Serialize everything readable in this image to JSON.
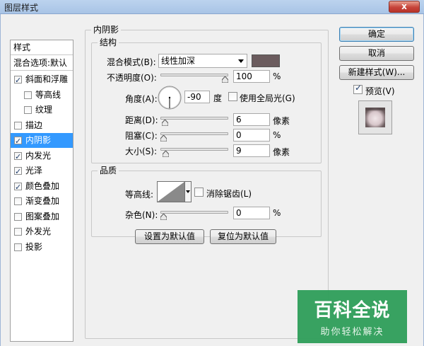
{
  "window": {
    "title": "图层样式",
    "close_label": "x"
  },
  "style_list": {
    "header": "样式",
    "blend_options": "混合选项:默认",
    "items": [
      {
        "label": "斜面和浮雕",
        "checked": true,
        "indent": false
      },
      {
        "label": "等高线",
        "checked": false,
        "indent": true
      },
      {
        "label": "纹理",
        "checked": false,
        "indent": true
      },
      {
        "label": "描边",
        "checked": false,
        "indent": false
      },
      {
        "label": "内阴影",
        "checked": true,
        "indent": false,
        "selected": true
      },
      {
        "label": "内发光",
        "checked": true,
        "indent": false
      },
      {
        "label": "光泽",
        "checked": true,
        "indent": false
      },
      {
        "label": "颜色叠加",
        "checked": true,
        "indent": false
      },
      {
        "label": "渐变叠加",
        "checked": false,
        "indent": false
      },
      {
        "label": "图案叠加",
        "checked": false,
        "indent": false
      },
      {
        "label": "外发光",
        "checked": false,
        "indent": false
      },
      {
        "label": "投影",
        "checked": false,
        "indent": false
      }
    ]
  },
  "panel": {
    "title": "内阴影",
    "structure": {
      "title": "结构",
      "blend_mode_label": "混合模式(B):",
      "blend_mode_value": "线性加深",
      "blend_color": "#6b5c5e",
      "opacity_label": "不透明度(O):",
      "opacity_value": "100",
      "opacity_unit": "%",
      "opacity_level": 1.0,
      "angle_label": "角度(A):",
      "angle_value": "-90",
      "angle_unit": "度",
      "global_light_label": "使用全局光(G)",
      "global_light_checked": false,
      "distance_label": "距离(D):",
      "distance_value": "6",
      "distance_unit": "像素",
      "distance_level": 0.02,
      "choke_label": "阻塞(C):",
      "choke_value": "0",
      "choke_unit": "%",
      "choke_level": 0,
      "size_label": "大小(S):",
      "size_value": "9",
      "size_unit": "像素",
      "size_level": 0.036
    },
    "quality": {
      "title": "品质",
      "contour_label": "等高线:",
      "antialias_label": "消除锯齿(L)",
      "antialias_checked": false,
      "noise_label": "杂色(N):",
      "noise_value": "0",
      "noise_unit": "%",
      "noise_level": 0
    },
    "make_default_label": "设置为默认值",
    "reset_default_label": "复位为默认值"
  },
  "buttons": {
    "ok": "确定",
    "cancel": "取消",
    "new_style": "新建样式(W)...",
    "preview_label": "预览(V)",
    "preview_checked": true
  },
  "watermark": {
    "main": "百科全说",
    "sub": "助你轻松解决"
  }
}
